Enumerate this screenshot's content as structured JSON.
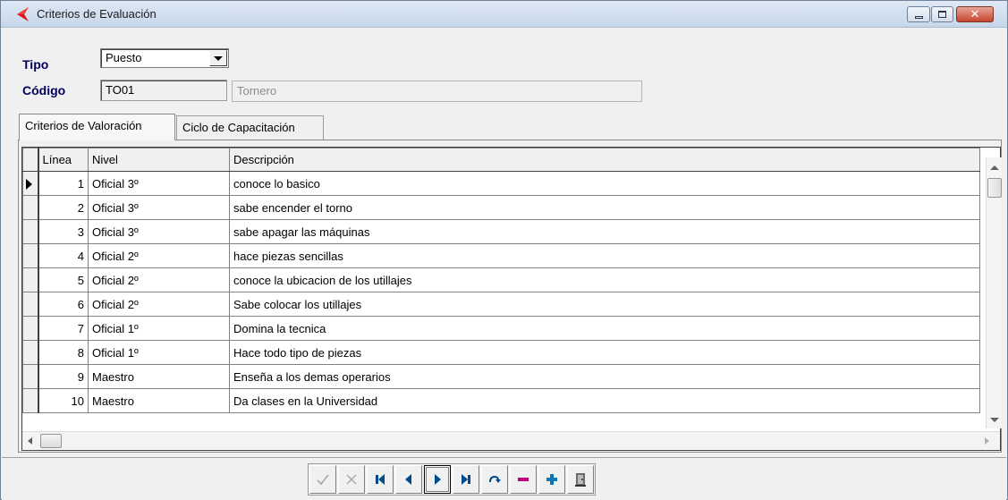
{
  "window": {
    "title": "Criterios de Evaluación",
    "icon": "red-arrow-icon",
    "controls": [
      "minimize-icon",
      "maximize-icon",
      "close-icon"
    ]
  },
  "header": {
    "tipo_label": "Tipo",
    "tipo_value": "Puesto",
    "codigo_label": "Código",
    "codigo_value": "TO01",
    "descripcion_value": "Tornero"
  },
  "tabs": [
    {
      "label": "Criterios de Valoración",
      "active": true
    },
    {
      "label": "Ciclo de Capacitación",
      "active": false
    }
  ],
  "grid": {
    "columns": [
      "Línea",
      "Nivel",
      "Descripción"
    ],
    "current_row": 0,
    "rows": [
      {
        "linea": "1",
        "nivel": "Oficial 3º",
        "descripcion": "conoce lo basico"
      },
      {
        "linea": "2",
        "nivel": "Oficial 3º",
        "descripcion": "sabe encender el torno"
      },
      {
        "linea": "3",
        "nivel": "Oficial 3º",
        "descripcion": "sabe apagar las máquinas"
      },
      {
        "linea": "4",
        "nivel": "Oficial 2º",
        "descripcion": "hace piezas sencillas"
      },
      {
        "linea": "5",
        "nivel": "Oficial 2º",
        "descripcion": "conoce la ubicacion de los utillajes"
      },
      {
        "linea": "6",
        "nivel": "Oficial 2º",
        "descripcion": "Sabe colocar los utillajes"
      },
      {
        "linea": "7",
        "nivel": "Oficial 1º",
        "descripcion": "Domina la tecnica"
      },
      {
        "linea": "8",
        "nivel": "Oficial 1º",
        "descripcion": "Hace todo tipo de piezas"
      },
      {
        "linea": "9",
        "nivel": "Maestro",
        "descripcion": "Enseña a los demas operarios"
      },
      {
        "linea": "10",
        "nivel": "Maestro",
        "descripcion": "Da clases en la Universidad"
      }
    ]
  },
  "navigator": {
    "buttons": [
      {
        "name": "post-icon",
        "enabled": false
      },
      {
        "name": "cancel-icon",
        "enabled": false
      },
      {
        "name": "first-record-icon",
        "enabled": true
      },
      {
        "name": "prior-record-icon",
        "enabled": true
      },
      {
        "name": "next-record-icon",
        "enabled": true
      },
      {
        "name": "last-record-icon",
        "enabled": true
      },
      {
        "name": "refresh-icon",
        "enabled": true
      },
      {
        "name": "delete-icon",
        "enabled": true
      },
      {
        "name": "insert-icon",
        "enabled": true
      },
      {
        "name": "exit-door-icon",
        "enabled": true
      }
    ]
  },
  "colors": {
    "label_navy": "#00005a",
    "nav_blue": "#004a8c",
    "delete_magenta": "#b4007c",
    "insert_teal": "#0a78b4"
  }
}
